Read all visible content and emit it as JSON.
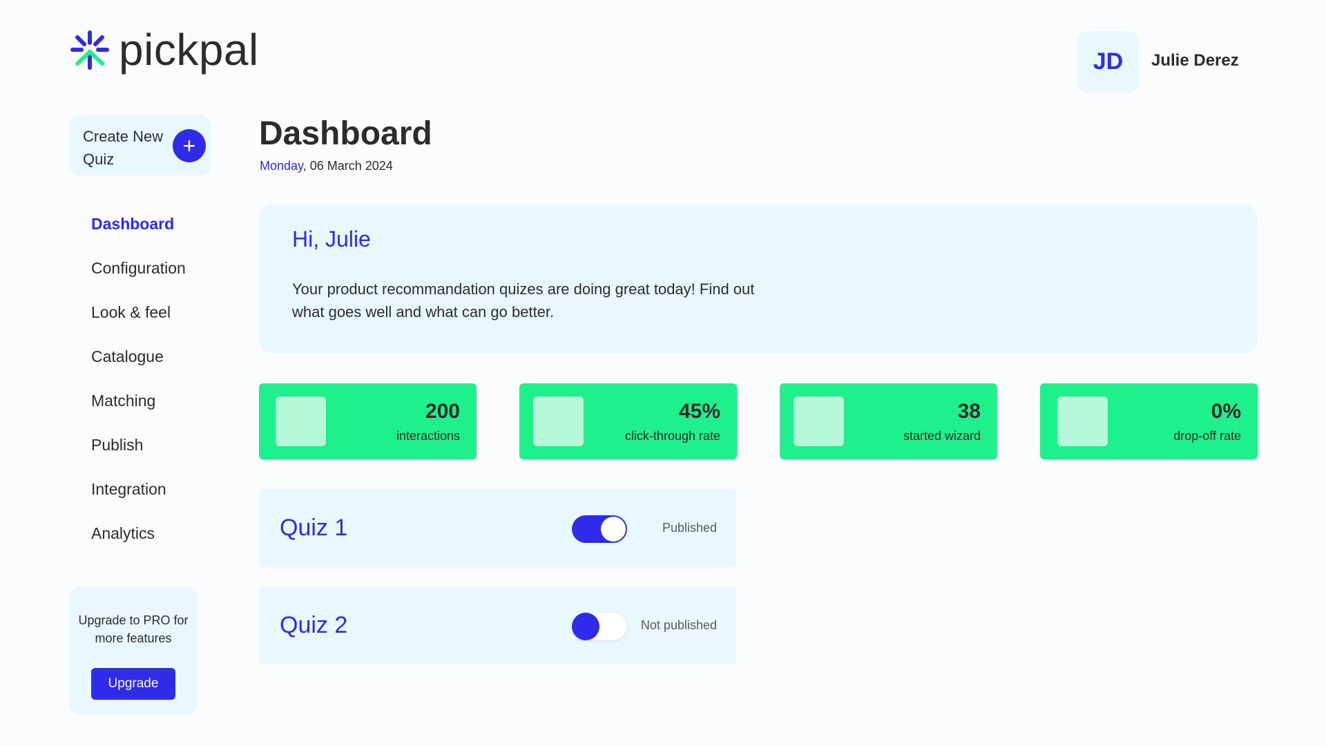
{
  "brand": {
    "name": "pickpal",
    "colors": {
      "primary": "#2F2CE9",
      "accent": "#1EF18C",
      "card": "#E8F8FE",
      "text": "#2C2C2C"
    },
    "icon": "pickpal-logo-icon"
  },
  "user": {
    "initials": "JD",
    "name": "Julie Derez"
  },
  "sidebar": {
    "create": {
      "label": "Create New Quiz",
      "icon": "plus-icon",
      "icon_glyph": "+"
    },
    "items": [
      {
        "label": "Dashboard",
        "active": true
      },
      {
        "label": "Configuration",
        "active": false
      },
      {
        "label": "Look & feel",
        "active": false
      },
      {
        "label": "Catalogue",
        "active": false
      },
      {
        "label": "Matching",
        "active": false
      },
      {
        "label": "Publish",
        "active": false
      },
      {
        "label": "Integration",
        "active": false
      },
      {
        "label": "Analytics",
        "active": false
      }
    ],
    "upgrade": {
      "text": "Upgrade to PRO for more features",
      "button_label": "Upgrade"
    }
  },
  "header": {
    "title": "Dashboard",
    "date_day": "Monday",
    "date_rest": ", 06 March 2024"
  },
  "greeting": {
    "title": "Hi, Julie",
    "body": "Your product recommandation quizes are doing great today! Find out what goes well and what can go better."
  },
  "stats": [
    {
      "value": "200",
      "label": "interactions"
    },
    {
      "value": "45%",
      "label": "click-through rate"
    },
    {
      "value": "38",
      "label": "started wizard"
    },
    {
      "value": "0%",
      "label": "drop-off rate"
    }
  ],
  "quizzes": [
    {
      "name": "Quiz 1",
      "published": true,
      "status": "Published"
    },
    {
      "name": "Quiz 2",
      "published": false,
      "status": "Not published"
    }
  ]
}
